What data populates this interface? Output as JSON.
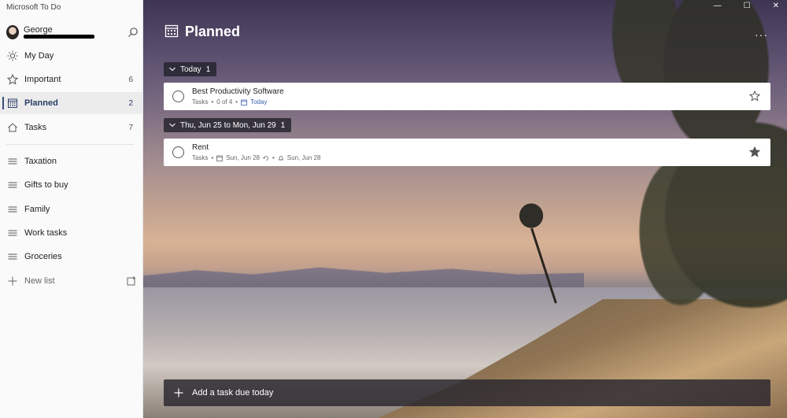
{
  "app": {
    "title": "Microsoft To Do"
  },
  "user": {
    "name": "George"
  },
  "sidebar": {
    "items": [
      {
        "label": "My Day",
        "count": ""
      },
      {
        "label": "Important",
        "count": "6"
      },
      {
        "label": "Planned",
        "count": "2"
      },
      {
        "label": "Tasks",
        "count": "7"
      },
      {
        "label": "Taxation",
        "count": ""
      },
      {
        "label": "Gifts to buy",
        "count": ""
      },
      {
        "label": "Family",
        "count": ""
      },
      {
        "label": "Work tasks",
        "count": ""
      },
      {
        "label": "Groceries",
        "count": ""
      }
    ],
    "new_list_label": "New list"
  },
  "main": {
    "title": "Planned",
    "groups": [
      {
        "label": "Today",
        "count": "1",
        "tasks": [
          {
            "title": "Best Productivity Software",
            "list": "Tasks",
            "steps": "0 of 4",
            "due": "Today"
          }
        ]
      },
      {
        "label": "Thu, Jun 25 to Mon, Jun 29",
        "count": "1",
        "tasks": [
          {
            "title": "Rent",
            "list": "Tasks",
            "due": "Sun, Jun 28",
            "reminder": "Sun, Jun 28"
          }
        ]
      }
    ],
    "add_task_label": "Add a task due today"
  },
  "colors": {
    "accent": "#3a4c7c",
    "today_blue": "#3a63b0"
  }
}
